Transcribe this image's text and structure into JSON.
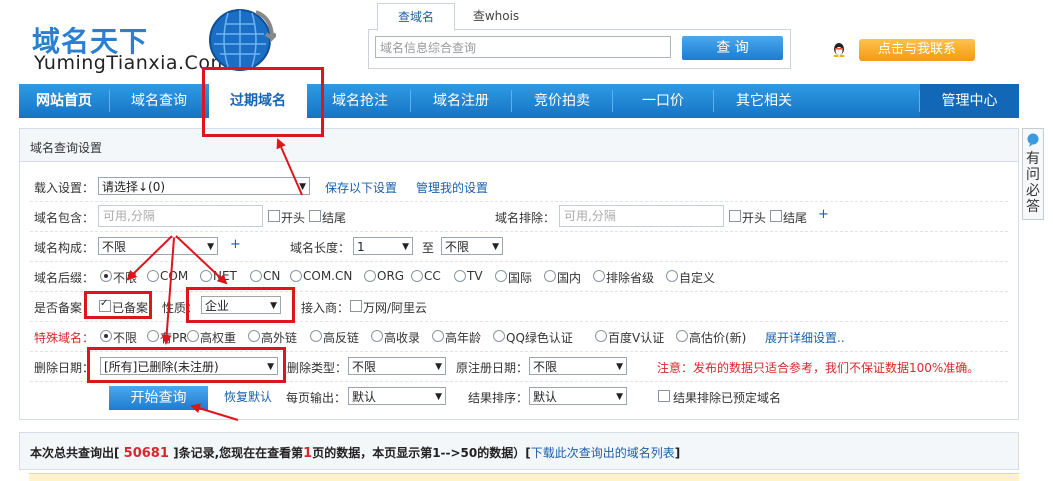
{
  "logo": {
    "cn": "域名天下",
    "en": "YumingTianxia.Com"
  },
  "search": {
    "tabs": [
      "查域名",
      "查whois"
    ],
    "placeholder": "域名信息综合查询",
    "button": "查 询"
  },
  "contact_button": "点击与我联系",
  "nav": [
    {
      "label": "网站首页",
      "active": false
    },
    {
      "label": "域名查询",
      "active": false
    },
    {
      "label": "过期域名",
      "active": true
    },
    {
      "label": "域名抢注",
      "active": false
    },
    {
      "label": "域名注册",
      "active": false
    },
    {
      "label": "竞价拍卖",
      "active": false
    },
    {
      "label": "一口价",
      "active": false
    },
    {
      "label": "其它相关",
      "active": false
    },
    {
      "label": "管理中心",
      "active": false
    }
  ],
  "panel_title": "域名查询设置",
  "load": {
    "label": "载入设置：",
    "select": "请选择↓(0)",
    "save_link": "保存以下设置",
    "manage_link": "管理我的设置"
  },
  "include": {
    "label": "域名包含：",
    "placeholder": "可用,分隔",
    "start": "开头",
    "end": "结尾"
  },
  "exclude": {
    "label": "域名排除：",
    "placeholder": "可用,分隔",
    "start": "开头",
    "end": "结尾",
    "plus": "+"
  },
  "compose": {
    "label": "域名构成：",
    "value": "不限",
    "plus": "+"
  },
  "length": {
    "label": "域名长度：",
    "from": "1",
    "to_label": "至",
    "to": "不限"
  },
  "suffix": {
    "label": "域名后缀：",
    "options": [
      "不限",
      "COM",
      "NET",
      "CN",
      "COM.CN",
      "ORG",
      "CC",
      "TV",
      "国际",
      "国内",
      "排除省级",
      "自定义"
    ]
  },
  "filing": {
    "label": "是否备案：",
    "checkbox": "已备案",
    "nature_label": "性质：",
    "nature_value": "企业",
    "access_label": "接入商：",
    "access_checkbox": "万网/阿里云"
  },
  "special": {
    "label": "特殊域名：",
    "options": [
      "不限",
      "有PR",
      "高权重",
      "高外链",
      "高反链",
      "高收录",
      "高年龄",
      "QQ绿色认证",
      "百度V认证",
      "高估价(新)"
    ],
    "detail_link": "展开详细设置.."
  },
  "delete": {
    "date_label": "删除日期：",
    "date_value": "[所有]已删除(未注册)",
    "type_label": "删除类型：",
    "type_value": "不限",
    "orig_label": "原注册日期：",
    "orig_value": "不限",
    "notice": "注意：发布的数据只适合参考，我们不保证数据100%准确。"
  },
  "actions": {
    "start": "开始查询",
    "reset": "恢复默认",
    "per_page_label": "每页输出：",
    "per_page_value": "默认",
    "sort_label": "结果排序：",
    "sort_value": "默认",
    "exclude_reserved": "结果排除已预定域名"
  },
  "result": {
    "prefix": "本次总共查询出[ ",
    "count": "50681",
    "mid1": " ]条记录,您现在在查看第",
    "page": "1",
    "mid2": "页的数据，本页显示第1-->50的数据）[",
    "download": "下载此次查询出的域名列表",
    "suffix": "]"
  },
  "side_tab": "有问必答"
}
